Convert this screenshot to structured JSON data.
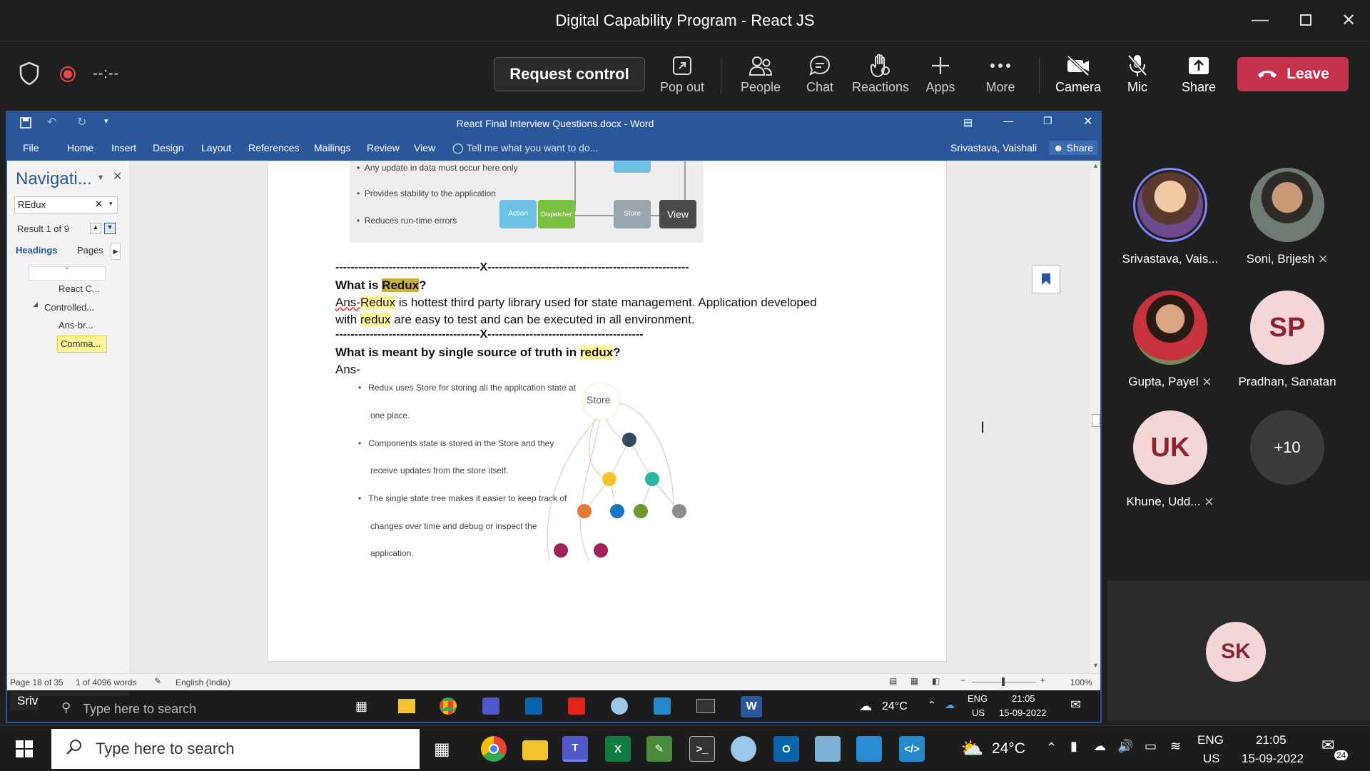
{
  "window": {
    "title": "Digital Capability Program - React JS"
  },
  "toolbar": {
    "timer": "--:--",
    "request_control": "Request control",
    "pop_out": "Pop out",
    "people": "People",
    "chat": "Chat",
    "reactions": "Reactions",
    "apps": "Apps",
    "more": "More",
    "camera": "Camera",
    "mic": "Mic",
    "share": "Share",
    "leave": "Leave"
  },
  "word": {
    "title": "React Final Interview Questions.docx - Word",
    "tabs": [
      "File",
      "Home",
      "Insert",
      "Design",
      "Layout",
      "References",
      "Mailings",
      "Review",
      "View"
    ],
    "tell_me": "Tell me what you want to do...",
    "user": "Srivastava, Vaishali",
    "share": "Share",
    "nav": {
      "title": "Navigati...",
      "search_value": "REdux",
      "result": "Result 1 of 9",
      "tab_headings": "Headings",
      "tab_pages": "Pages",
      "items": [
        "React C...",
        "Controlled...",
        "Ans-br...",
        "Comma..."
      ]
    },
    "doc": {
      "fig1_bullets": [
        "Any update in data must occur here only",
        "Provides stability to the application",
        "Reduces run-time errors"
      ],
      "fig1_boxes": [
        "Action",
        "Dispatcher",
        "Store",
        "View"
      ],
      "sep1": "--------------------------------------X-----------------------------------------------------",
      "q1_pre": "What is ",
      "q1_hl": "Redux",
      "q1_post": "?",
      "a1_pre": "Ans-",
      "a1_hl": "Redux",
      "a1_post": " is hottest third party library used for state management. Application developed",
      "a1_l2_pre": "with ",
      "a1_l2_hl": "redux",
      "a1_l2_post": " are easy to test and can be executed in all environment.",
      "sep2": "--------------------------------------X-----------------------------------------",
      "q2_pre": "What is meant by single source of truth in ",
      "q2_hl": "redux",
      "q2_post": "?",
      "a2": "Ans-",
      "fig2_bullets": [
        "Redux uses Store for storing all the application state at",
        "one place.",
        "Components state is stored in the Store and they",
        "receive updates from the store itself.",
        "The single state tree makes it easier to keep track of",
        "changes over time and debug or inspect the",
        "application."
      ],
      "store_label": "Store"
    },
    "status": {
      "page": "Page 18 of 35",
      "words": "1 of 4096 words",
      "lang": "English (India)",
      "zoom": "100%"
    },
    "presenter": "Srivastava, Vaishali",
    "inner_search": "Type here to search",
    "inner_temp": "24°C",
    "inner_lang": "ENG",
    "inner_region": "US",
    "inner_time": "21:05",
    "inner_date": "15-09-2022"
  },
  "participants": [
    {
      "name": "Srivastava, Vais...",
      "initials": "",
      "muted": false
    },
    {
      "name": "Soni, Brijesh",
      "initials": "",
      "muted": true
    },
    {
      "name": "Gupta, Payel",
      "initials": "",
      "muted": true
    },
    {
      "name": "Pradhan, Sanatan",
      "initials": "SP",
      "muted": false
    },
    {
      "name": "Khune, Udd...",
      "initials": "UK",
      "muted": true
    },
    {
      "name": "",
      "initials": "+10",
      "muted": false
    }
  ],
  "self_tile": {
    "initials": "SK"
  },
  "taskbar": {
    "search": "Type here to search",
    "temp": "24°C",
    "lang": "ENG",
    "region": "US",
    "time": "21:05",
    "date": "15-09-2022",
    "notif": "24"
  },
  "colors": {
    "leave": "#c4314b",
    "word": "#2b579a",
    "highlight": "#fff59d",
    "avatar_bg": "#f4d6d8",
    "avatar_text": "#8a2433"
  }
}
